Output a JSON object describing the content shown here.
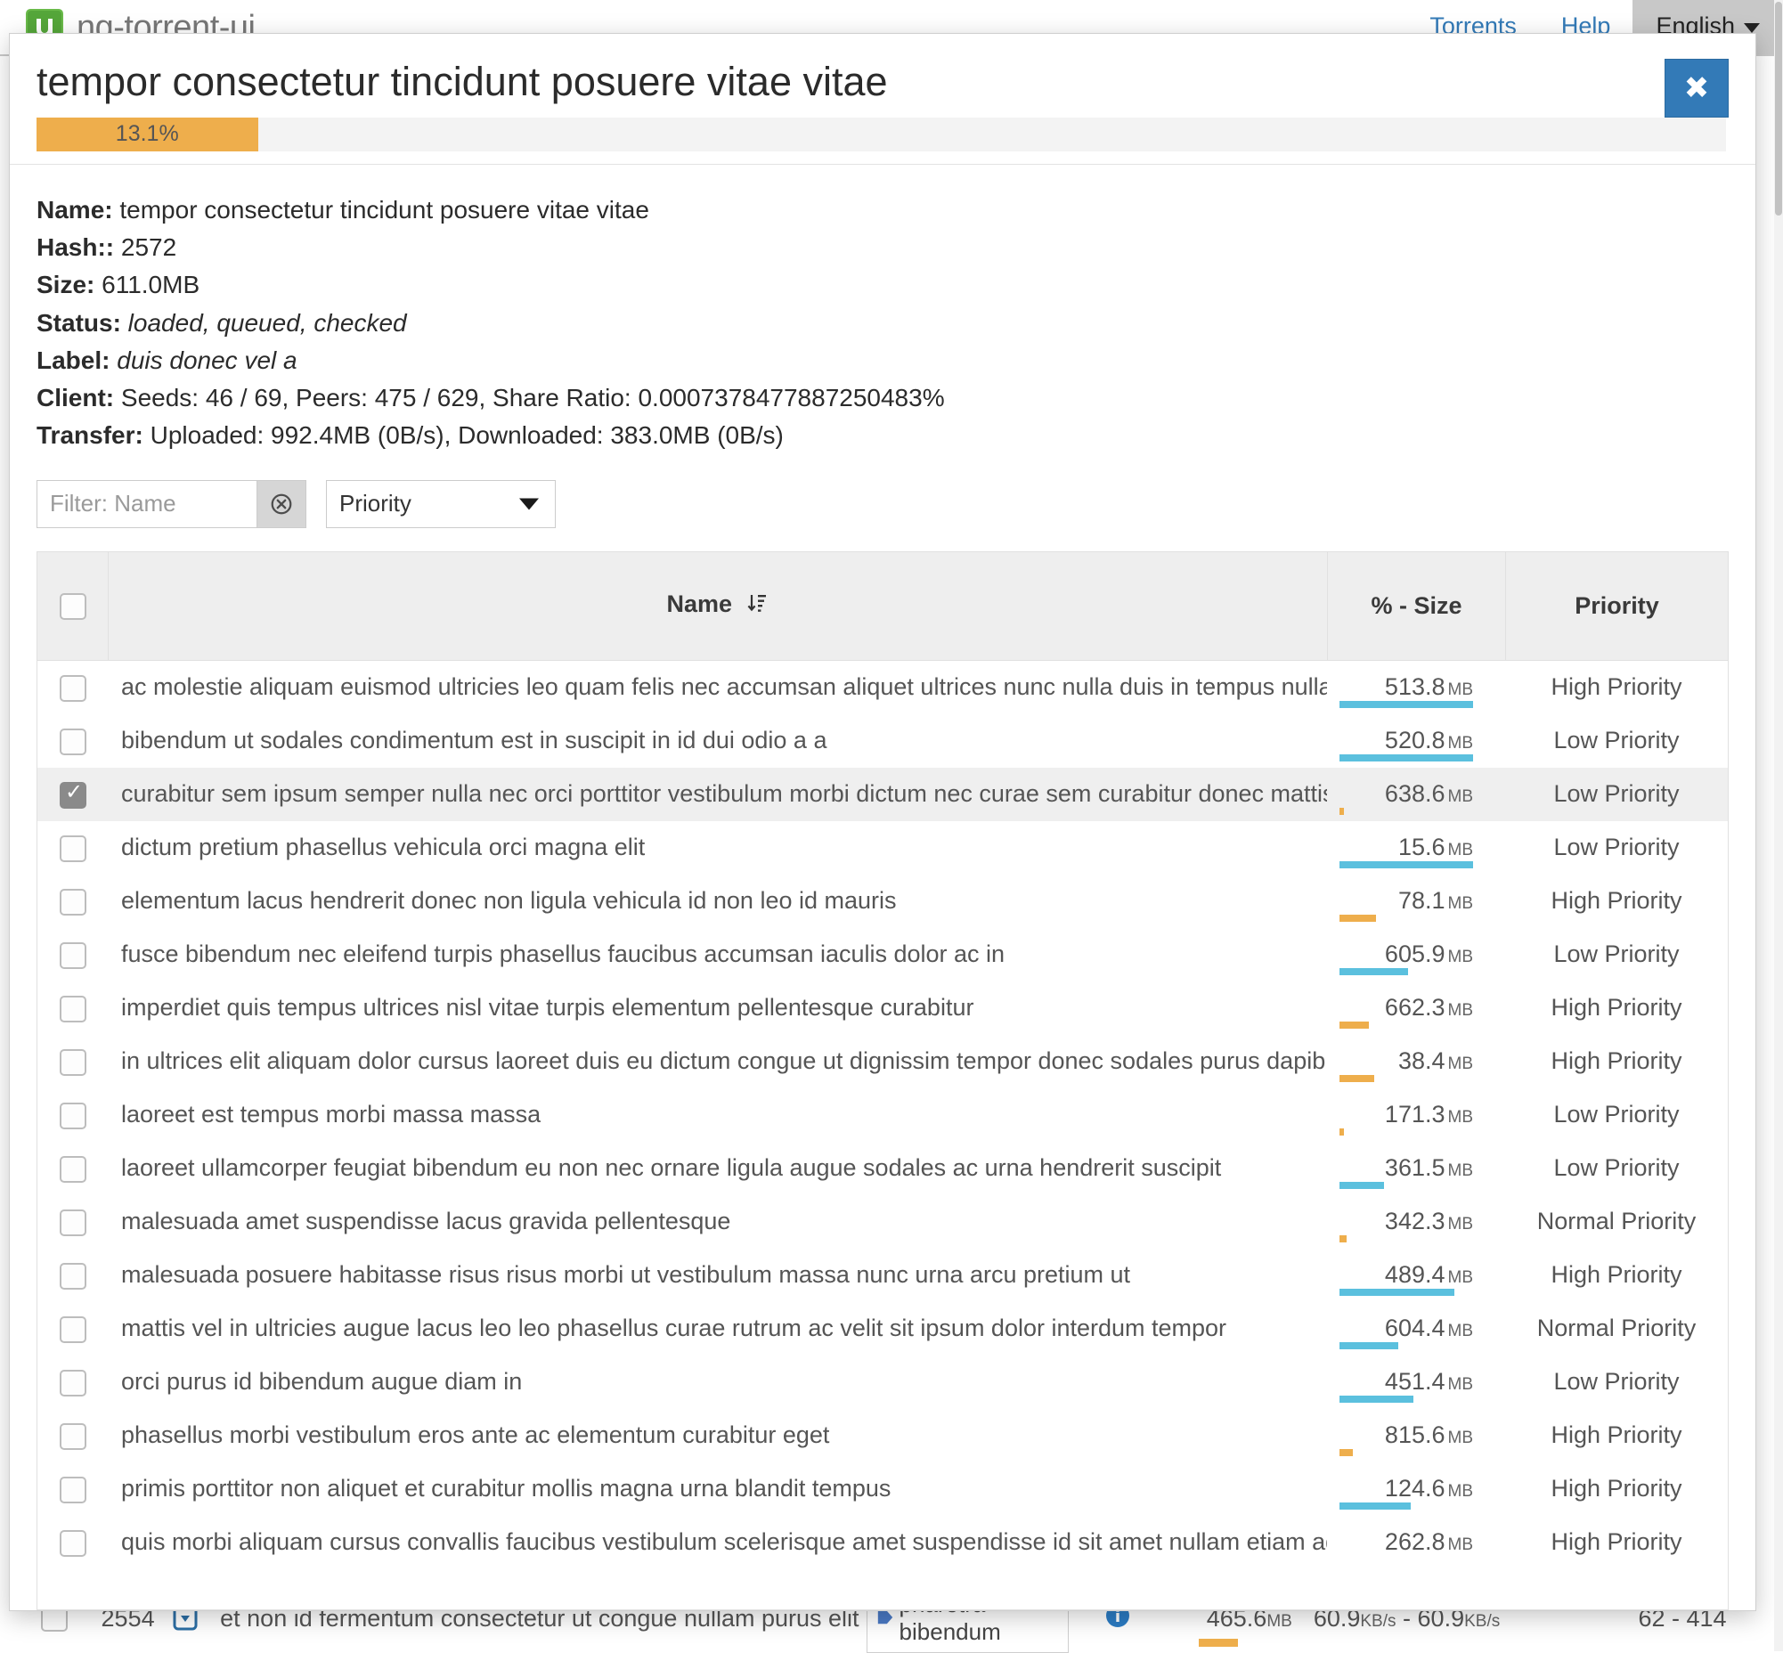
{
  "navbar": {
    "brand": "ng-torrent-ui",
    "logo_icon": "utorrent-logo-icon",
    "links": [
      {
        "label": "Torrents",
        "name": "nav-link-torrents"
      },
      {
        "label": "Help",
        "name": "nav-link-help"
      }
    ],
    "language": {
      "label": "English",
      "caret_icon": "caret-down-icon"
    }
  },
  "modal": {
    "title": "tempor consectetur tincidunt posuere vitae vitae",
    "close_label": "✖",
    "progress": {
      "percent_label": "13.1%",
      "percent_value": 13.1,
      "fill_color": "#eeae4c",
      "track_color": "#f3f3f3"
    },
    "details": [
      {
        "key": "Name:",
        "value": "tempor consectetur tincidunt posuere vitae vitae",
        "italic": false
      },
      {
        "key": "Hash::",
        "value": "2572",
        "italic": false
      },
      {
        "key": "Size:",
        "value": "611.0MB",
        "italic": false
      },
      {
        "key": "Status:",
        "value": "loaded, queued, checked",
        "italic": true
      },
      {
        "key": "Label:",
        "value": "duis donec vel a",
        "italic": true
      },
      {
        "key": "Client:",
        "value": "Seeds: 46 / 69, Peers: 475 / 629, Share Ratio: 0.0007378477887250483%",
        "italic": false
      },
      {
        "key": "Transfer:",
        "value": "Uploaded: 992.4MB (0B/s), Downloaded: 383.0MB (0B/s)",
        "italic": false
      }
    ],
    "filter": {
      "placeholder": "Filter: Name",
      "value": "",
      "clear_icon": "clear-circle-x-icon",
      "select_value": "Priority",
      "select_caret_icon": "caret-down-icon"
    },
    "table": {
      "headers": {
        "select_all": "",
        "name": "Name",
        "name_sort_icon": "sort-descending-icon",
        "size": "% - Size",
        "priority": "Priority"
      },
      "rows": [
        {
          "checked": false,
          "selected": false,
          "name": "ac molestie aliquam euismod ultricies leo quam felis nec accumsan aliquet ultrices nunc nulla duis in tempus nullam volutpat",
          "size": "513.8",
          "unit": "MB",
          "priority": "High Priority",
          "bar_pct": 100,
          "bar_color": "blue"
        },
        {
          "checked": false,
          "selected": false,
          "name": "bibendum ut sodales condimentum est in suscipit in id dui odio a a",
          "size": "520.8",
          "unit": "MB",
          "priority": "Low Priority",
          "bar_pct": 100,
          "bar_color": "blue"
        },
        {
          "checked": true,
          "selected": true,
          "name": "curabitur sem ipsum semper nulla nec orci porttitor vestibulum morbi dictum nec curae sem curabitur donec mattis nunc",
          "size": "638.6",
          "unit": "MB",
          "priority": "Low Priority",
          "bar_pct": 3,
          "bar_color": "orange"
        },
        {
          "checked": false,
          "selected": false,
          "name": "dictum pretium phasellus vehicula orci magna elit",
          "size": "15.6",
          "unit": "MB",
          "priority": "Low Priority",
          "bar_pct": 100,
          "bar_color": "blue"
        },
        {
          "checked": false,
          "selected": false,
          "name": "elementum lacus hendrerit donec non ligula vehicula id non leo id mauris",
          "size": "78.1",
          "unit": "MB",
          "priority": "High Priority",
          "bar_pct": 27,
          "bar_color": "orange"
        },
        {
          "checked": false,
          "selected": false,
          "name": "fusce bibendum nec eleifend turpis phasellus faucibus accumsan iaculis dolor ac in",
          "size": "605.9",
          "unit": "MB",
          "priority": "Low Priority",
          "bar_pct": 51,
          "bar_color": "blue"
        },
        {
          "checked": false,
          "selected": false,
          "name": "imperdiet quis tempus ultrices nisl vitae turpis elementum pellentesque curabitur",
          "size": "662.3",
          "unit": "MB",
          "priority": "High Priority",
          "bar_pct": 22,
          "bar_color": "orange"
        },
        {
          "checked": false,
          "selected": false,
          "name": "in ultrices elit aliquam dolor cursus laoreet duis eu dictum congue ut dignissim tempor donec sodales purus dapibus imperdiet",
          "size": "38.4",
          "unit": "MB",
          "priority": "High Priority",
          "bar_pct": 26,
          "bar_color": "orange"
        },
        {
          "checked": false,
          "selected": false,
          "name": "laoreet est tempus morbi massa massa",
          "size": "171.3",
          "unit": "MB",
          "priority": "Low Priority",
          "bar_pct": 3,
          "bar_color": "orange"
        },
        {
          "checked": false,
          "selected": false,
          "name": "laoreet ullamcorper feugiat bibendum eu non nec ornare ligula augue sodales ac urna hendrerit suscipit",
          "size": "361.5",
          "unit": "MB",
          "priority": "Low Priority",
          "bar_pct": 33,
          "bar_color": "blue"
        },
        {
          "checked": false,
          "selected": false,
          "name": "malesuada amet suspendisse lacus gravida pellentesque",
          "size": "342.3",
          "unit": "MB",
          "priority": "Normal Priority",
          "bar_pct": 5,
          "bar_color": "orange"
        },
        {
          "checked": false,
          "selected": false,
          "name": "malesuada posuere habitasse risus risus morbi ut vestibulum massa nunc urna arcu pretium ut",
          "size": "489.4",
          "unit": "MB",
          "priority": "High Priority",
          "bar_pct": 86,
          "bar_color": "blue"
        },
        {
          "checked": false,
          "selected": false,
          "name": "mattis vel in ultricies augue lacus leo leo phasellus curae rutrum ac velit sit ipsum dolor interdum tempor",
          "size": "604.4",
          "unit": "MB",
          "priority": "Normal Priority",
          "bar_pct": 44,
          "bar_color": "blue"
        },
        {
          "checked": false,
          "selected": false,
          "name": "orci purus id bibendum augue diam in",
          "size": "451.4",
          "unit": "MB",
          "priority": "Low Priority",
          "bar_pct": 55,
          "bar_color": "blue"
        },
        {
          "checked": false,
          "selected": false,
          "name": "phasellus morbi vestibulum eros ante ac elementum curabitur eget",
          "size": "815.6",
          "unit": "MB",
          "priority": "High Priority",
          "bar_pct": 10,
          "bar_color": "orange"
        },
        {
          "checked": false,
          "selected": false,
          "name": "primis porttitor non aliquet et curabitur mollis magna urna blandit tempus",
          "size": "124.6",
          "unit": "MB",
          "priority": "High Priority",
          "bar_pct": 53,
          "bar_color": "blue"
        },
        {
          "checked": false,
          "selected": false,
          "name": "quis morbi aliquam cursus convallis faucibus vestibulum scelerisque amet suspendisse id sit amet nullam etiam adipiscing tortor",
          "size": "262.8",
          "unit": "MB",
          "priority": "High Priority",
          "bar_pct": 0,
          "bar_color": "blue"
        }
      ]
    }
  },
  "background_row": {
    "id": "2554",
    "caret_icon": "caret-down-badge-icon",
    "name": "et non id fermentum consectetur ut congue nullam purus elit pellentesque",
    "label_tag": "pharetra bibendum",
    "label_tag_icon": "label-tag-icon",
    "info_icon": "info-circle-icon",
    "size": "465.6",
    "size_unit": "MB",
    "down_speed": "60.9",
    "down_unit": "KB/s",
    "speed_sep": "-",
    "up_speed": "60.9",
    "up_unit": "KB/s",
    "peers": "62 - 414"
  }
}
